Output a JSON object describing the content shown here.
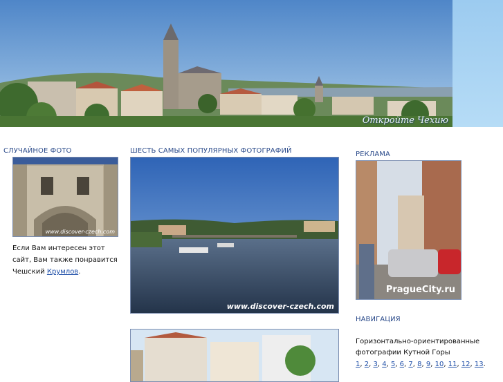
{
  "banner": {
    "caption": "Откройте Чехию"
  },
  "random_photo": {
    "title": "СЛУЧАЙНОЕ ФОТО",
    "watermark": "www.discover-czech.com",
    "text_before": "Если Вам интересен этот сайт, Вам также понравится Чешский",
    "link": "Крумлов",
    "text_after": "."
  },
  "popular": {
    "title": "ШЕСТЬ САМЫХ ПОПУЛЯРНЫХ ФОТОГРАФИЙ",
    "watermark": "www.discover-czech.com"
  },
  "ads": {
    "title": "РЕКЛАМА",
    "watermark": "PragueCity.ru"
  },
  "navigation": {
    "title": "НАВИГАЦИЯ",
    "text": "Горизонтально-ориентированные фотографии Кутной Горы",
    "pages": [
      "1",
      "2",
      "3",
      "4",
      "5",
      "6",
      "7",
      "8",
      "9",
      "10",
      "11",
      "12",
      "13"
    ],
    "end": "."
  }
}
